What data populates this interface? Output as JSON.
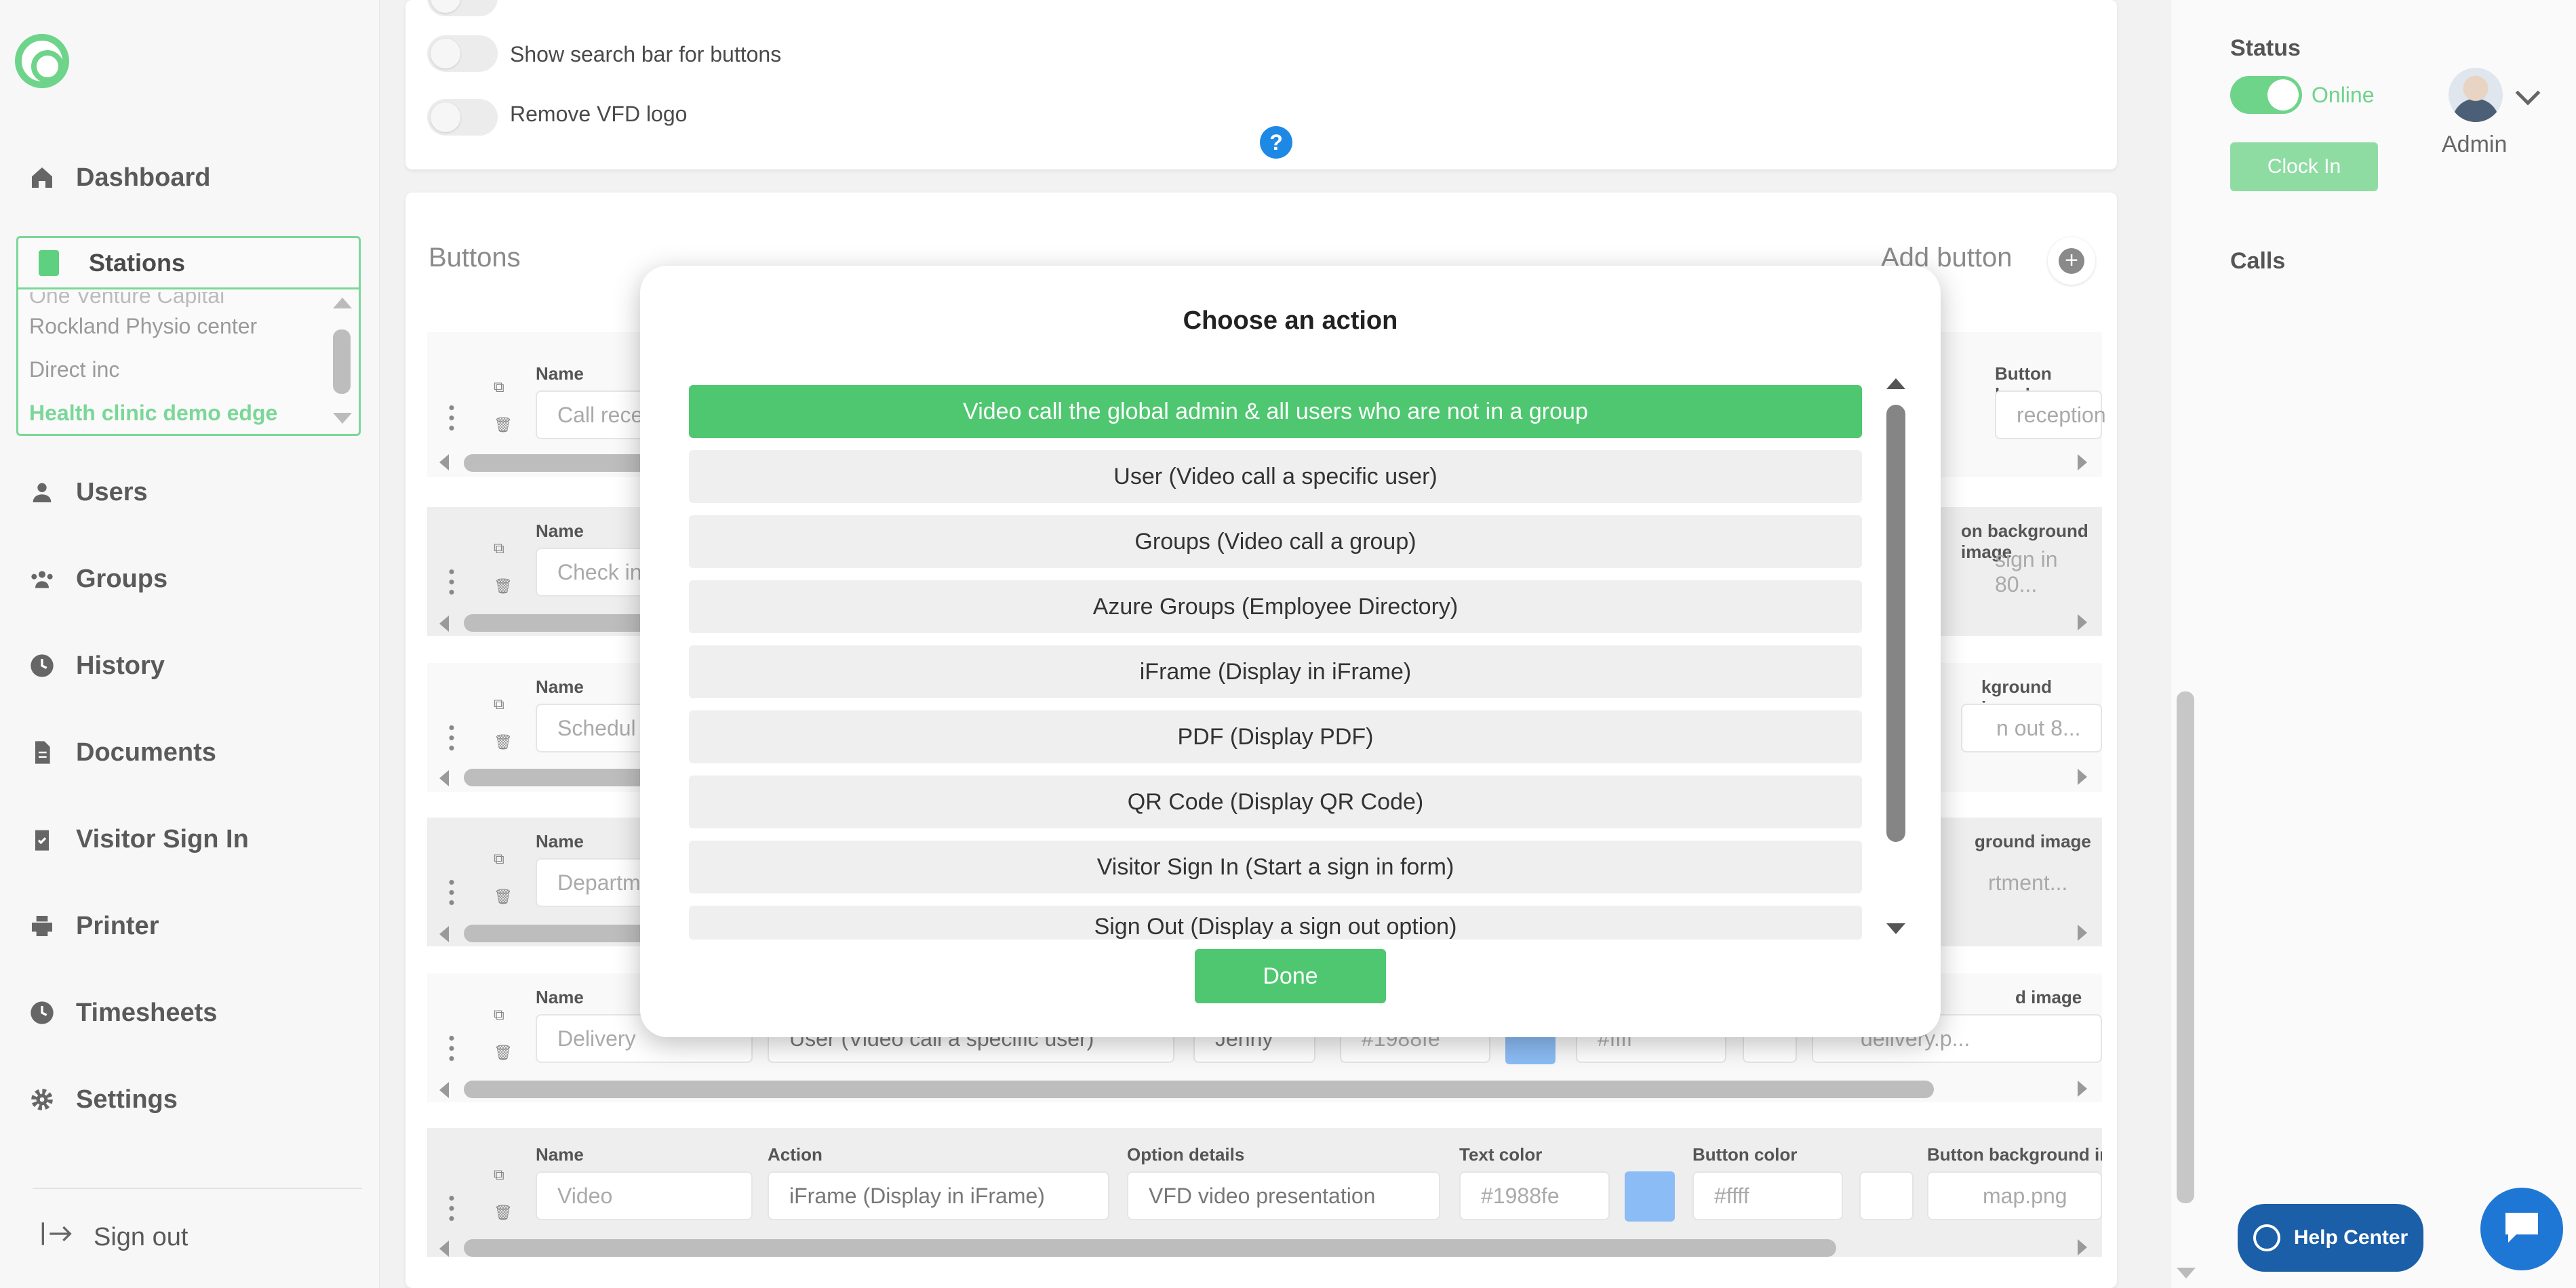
{
  "sidebar": {
    "nav": [
      {
        "label": "Dashboard",
        "icon": "home-icon"
      },
      {
        "label": "Users",
        "icon": "user-icon"
      },
      {
        "label": "Groups",
        "icon": "groups-icon"
      },
      {
        "label": "History",
        "icon": "clock-icon"
      },
      {
        "label": "Documents",
        "icon": "document-icon"
      },
      {
        "label": "Visitor Sign In",
        "icon": "clipboard-check-icon"
      },
      {
        "label": "Printer",
        "icon": "printer-icon"
      },
      {
        "label": "Timesheets",
        "icon": "clock-icon"
      },
      {
        "label": "Settings",
        "icon": "gear-icon"
      }
    ],
    "stations": {
      "label": "Stations",
      "items": [
        "One Venture Capital",
        "Rockland Physio center",
        "Direct inc",
        "Health clinic demo edge"
      ],
      "selected": "Health clinic demo edge"
    },
    "signout": "Sign out"
  },
  "settings": {
    "toggles": [
      {
        "label": "Show search bar for buttons",
        "on": false
      },
      {
        "label": "Remove VFD logo",
        "on": false
      }
    ],
    "help_glyph": "?"
  },
  "buttons_section": {
    "title": "Buttons",
    "add_label": "Add button",
    "field_labels": {
      "name": "Name",
      "action": "Action",
      "option_details": "Option details",
      "text_color": "Text color",
      "button_color": "Button color",
      "bg_image": "Button backgroun",
      "bg_image_b": "on background image",
      "bg_image_c": "kground image",
      "bg_image_d": "ground image",
      "bg_image_e": "d image",
      "bg_image_f": "Button background ima"
    },
    "rows": [
      {
        "name": "Call rece",
        "bg_image": "reception"
      },
      {
        "name": "Check in",
        "bg_image": "sign in 80..."
      },
      {
        "name": "Schedul",
        "bg_image": "n out 8..."
      },
      {
        "name": "Departm",
        "bg_image": "rtment..."
      },
      {
        "name": "Delivery",
        "action": "User (Video call a specific user)",
        "option": "Jenny",
        "text_color": "#1988fe",
        "button_color": "#ffff",
        "bg_image": "delivery.p..."
      },
      {
        "name": "Video",
        "action": "iFrame (Display in iFrame)",
        "option": "VFD video presentation",
        "text_color": "#1988fe",
        "button_color": "#ffff",
        "bg_image": "map.png"
      }
    ]
  },
  "modal": {
    "title": "Choose an action",
    "options": [
      "Video call the global admin & all users who are not in a group",
      "User (Video call a specific user)",
      "Groups (Video call a group)",
      "Azure Groups (Employee Directory)",
      "iFrame (Display in iFrame)",
      "PDF (Display PDF)",
      "QR Code (Display QR Code)",
      "Visitor Sign In (Start a sign in form)",
      "Sign Out (Display a sign out option)"
    ],
    "selected_index": 0,
    "done": "Done"
  },
  "right_panel": {
    "status_label": "Status",
    "status_value": "Online",
    "clock_in": "Clock In",
    "user_name": "Admin",
    "calls_label": "Calls",
    "help_center": "Help Center"
  },
  "colors": {
    "accent": "#4fc770",
    "help": "#1a5fa8",
    "chat": "#1e77d4"
  }
}
